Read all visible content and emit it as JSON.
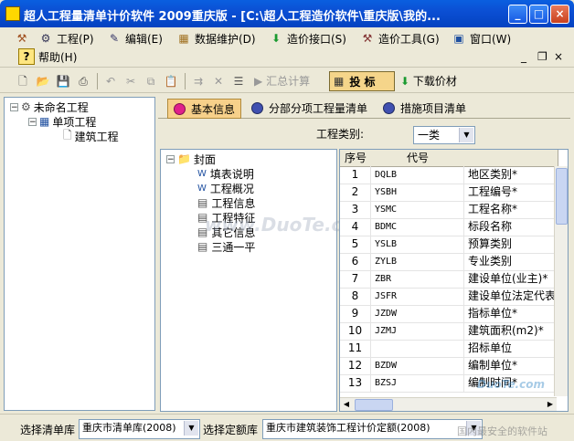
{
  "window": {
    "title": "超人工程量清单计价软件  2009重庆版 - [C:\\超人工程造价软件\\重庆版\\我的...",
    "min": "_",
    "max": "□",
    "close": "×"
  },
  "menu": {
    "project": "工程(P)",
    "edit": "编辑(E)",
    "data_maint": "数据维护(D)",
    "interface": "造价接口(S)",
    "tools": "造价工具(G)",
    "window": "窗口(W)",
    "help": "帮助(H)",
    "child_min": "_",
    "child_restore": "❐",
    "child_close": "×"
  },
  "toolbar": {
    "summary": "汇总计算",
    "bid": "投    标",
    "download": "下载价材"
  },
  "left_tree": {
    "root": "未命名工程",
    "unit": "单项工程",
    "building": "建筑工程"
  },
  "tabs": [
    {
      "label": "基本信息",
      "color": "#e0208a"
    },
    {
      "label": "分部分项工程量清单",
      "color": "#4050b0"
    },
    {
      "label": "措施项目清单",
      "color": "#4050b0"
    }
  ],
  "project_type": {
    "label": "工程类别:",
    "value": "一类"
  },
  "doc_tree": {
    "root": "封面",
    "items": [
      "填表说明",
      "工程概况",
      "工程信息",
      "工程特征",
      "其它信息",
      "三通一平"
    ]
  },
  "grid": {
    "headers": [
      "序号",
      "代号",
      ""
    ],
    "rows": [
      [
        "1",
        "DQLB",
        "地区类别*"
      ],
      [
        "2",
        "YSBH",
        "工程编号*"
      ],
      [
        "3",
        "YSMC",
        "工程名称*"
      ],
      [
        "4",
        "BDMC",
        "标段名称"
      ],
      [
        "5",
        "YSLB",
        "预算类别"
      ],
      [
        "6",
        "ZYLB",
        "专业类别"
      ],
      [
        "7",
        "ZBR",
        "建设单位(业主)*"
      ],
      [
        "8",
        "JSFR",
        "建设单位法定代表"
      ],
      [
        "9",
        "JZDW",
        "指标单位*"
      ],
      [
        "10",
        "JZMJ",
        "建筑面积(m2)*"
      ],
      [
        "11",
        "",
        "招标单位"
      ],
      [
        "12",
        "BZDW",
        "编制单位*"
      ],
      [
        "13",
        "BZSJ",
        "编制时间*"
      ]
    ]
  },
  "status": {
    "list_lib_label": "选择清单库",
    "list_lib_value": "重庆市清单库(2008)",
    "quota_lib_label": "选择定额库",
    "quota_lib_value": "重庆市建筑装饰工程计价定额(2008)"
  },
  "watermarks": [
    "www.DuoTe.com",
    "DuoTe.com",
    "国内最安全的软件站"
  ]
}
